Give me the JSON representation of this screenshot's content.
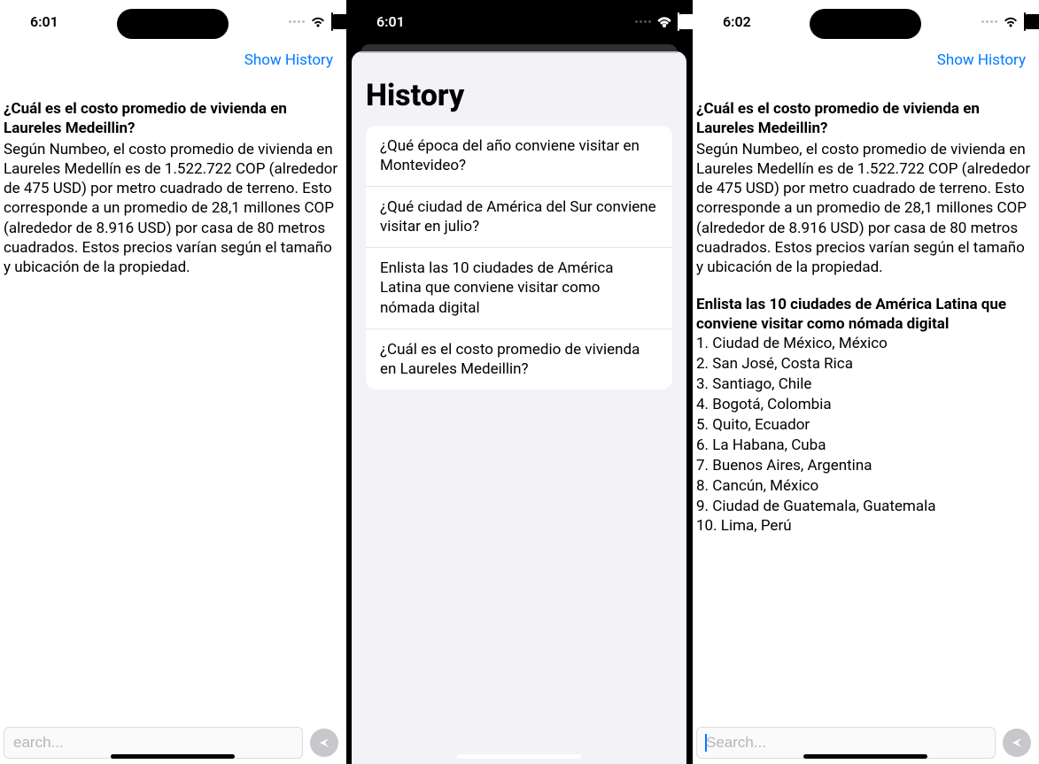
{
  "phone1": {
    "time": "6:01",
    "show_history": "Show History",
    "question": "¿Cuál es el costo promedio de vivienda en Laureles Medeillin?",
    "answer": "Según Numbeo, el costo promedio de vivienda en Laureles Medellín es de 1.522.722 COP (alrededor de 475 USD) por metro cuadrado de terreno. Esto corresponde a un promedio de 28,1 millones COP (alrededor de 8.916 USD) por casa de 80 metros cuadrados. Estos precios varían según el tamaño y ubicación de la propiedad.",
    "search_placeholder": "earch..."
  },
  "phone2": {
    "time": "6:01",
    "modal_title": "History",
    "history": [
      "¿Qué época del año conviene visitar en Montevideo?",
      "¿Qué ciudad de América del Sur conviene visitar en julio?",
      "Enlista las 10 ciudades de América Latina que conviene visitar como nómada digital",
      "¿Cuál es el costo promedio de vivienda en Laureles Medeillin?"
    ]
  },
  "phone3": {
    "time": "6:02",
    "show_history": "Show History",
    "question": "¿Cuál es el costo promedio de vivienda en Laureles Medeillin?",
    "answer": "Según Numbeo, el costo promedio de vivienda en Laureles Medellín es de 1.522.722 COP (alrededor de 475 USD) por metro cuadrado de terreno. Esto corresponde a un promedio de 28,1 millones COP (alrededor de 8.916 USD) por casa de 80 metros cuadrados. Estos precios varían según el tamaño y ubicación de la propiedad.",
    "list_question": "Enlista las 10 ciudades de América Latina que conviene visitar como nómada digital",
    "cities": [
      "1. Ciudad de México, México",
      "2. San José, Costa Rica",
      "3. Santiago, Chile",
      "4. Bogotá, Colombia",
      "5. Quito, Ecuador",
      "6. La Habana, Cuba",
      "7. Buenos Aires, Argentina",
      "8. Cancún, México",
      "9. Ciudad de Guatemala, Guatemala",
      "10. Lima, Perú"
    ],
    "search_placeholder": "Search..."
  }
}
